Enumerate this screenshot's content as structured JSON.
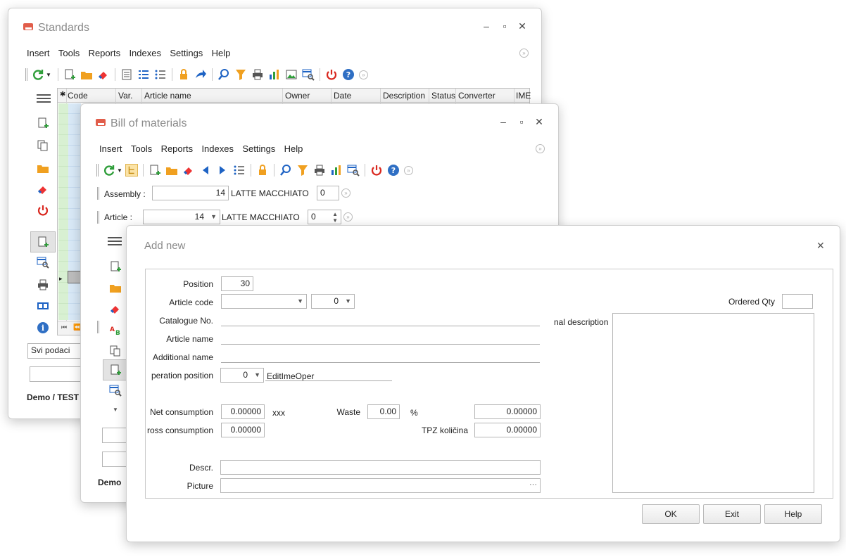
{
  "standards": {
    "title": "Standards",
    "menu": [
      "Insert",
      "Tools",
      "Reports",
      "Indexes",
      "Settings",
      "Help"
    ],
    "columns": [
      "Code",
      "Var.",
      "Article name",
      "Owner",
      "Date",
      "Description",
      "Status",
      "Converter",
      "IME"
    ],
    "filter_value": "Svi podaci",
    "status": "Demo / TEST"
  },
  "bom": {
    "title": "Bill of materials",
    "menu": [
      "Insert",
      "Tools",
      "Reports",
      "Indexes",
      "Settings",
      "Help"
    ],
    "assembly_label": "Assembly :",
    "assembly_value": "14",
    "assembly_name": "LATTE MACCHIATO",
    "assembly_var": "0",
    "article_label": "Article :",
    "article_value": "14",
    "article_name": "LATTE MACCHIATO",
    "article_var": "0",
    "status": "Demo"
  },
  "addnew": {
    "title": "Add new",
    "position_label": "Position",
    "position_value": "30",
    "article_code_label": "Article code",
    "article_code_value": "",
    "article_code_var": "0",
    "catalogue_label": "Catalogue No.",
    "article_name_label": "Article name",
    "additional_name_label": "Additional name",
    "operation_position_label": "peration position",
    "operation_position_value": "0",
    "operation_name": "EditImeOper",
    "net_consumption_label": "Net consumption",
    "net_consumption_value": "0.00000",
    "net_unit": "xxx",
    "waste_label": "Waste",
    "waste_value": "0.00",
    "waste_unit": "%",
    "waste_result": "0.00000",
    "gross_consumption_label": "ross consumption",
    "gross_consumption_value": "0.00000",
    "tpz_label": "TPZ količina",
    "tpz_value": "0.00000",
    "descr_label": "Descr.",
    "picture_label": "Picture",
    "picture_button": "···",
    "ordered_qty_label": "Ordered Qty",
    "additional_description_label": "nal description",
    "ok": "OK",
    "exit": "Exit",
    "help": "Help"
  },
  "colors": {
    "grid_green": "#d8f0d2",
    "grid_blue": "#d9e9f7",
    "power_red": "#d9281f",
    "help_blue": "#2f6fc4",
    "folder_orange": "#f0a020",
    "accent_blue": "#1e63c4",
    "refresh_green": "#2f9e3a"
  }
}
